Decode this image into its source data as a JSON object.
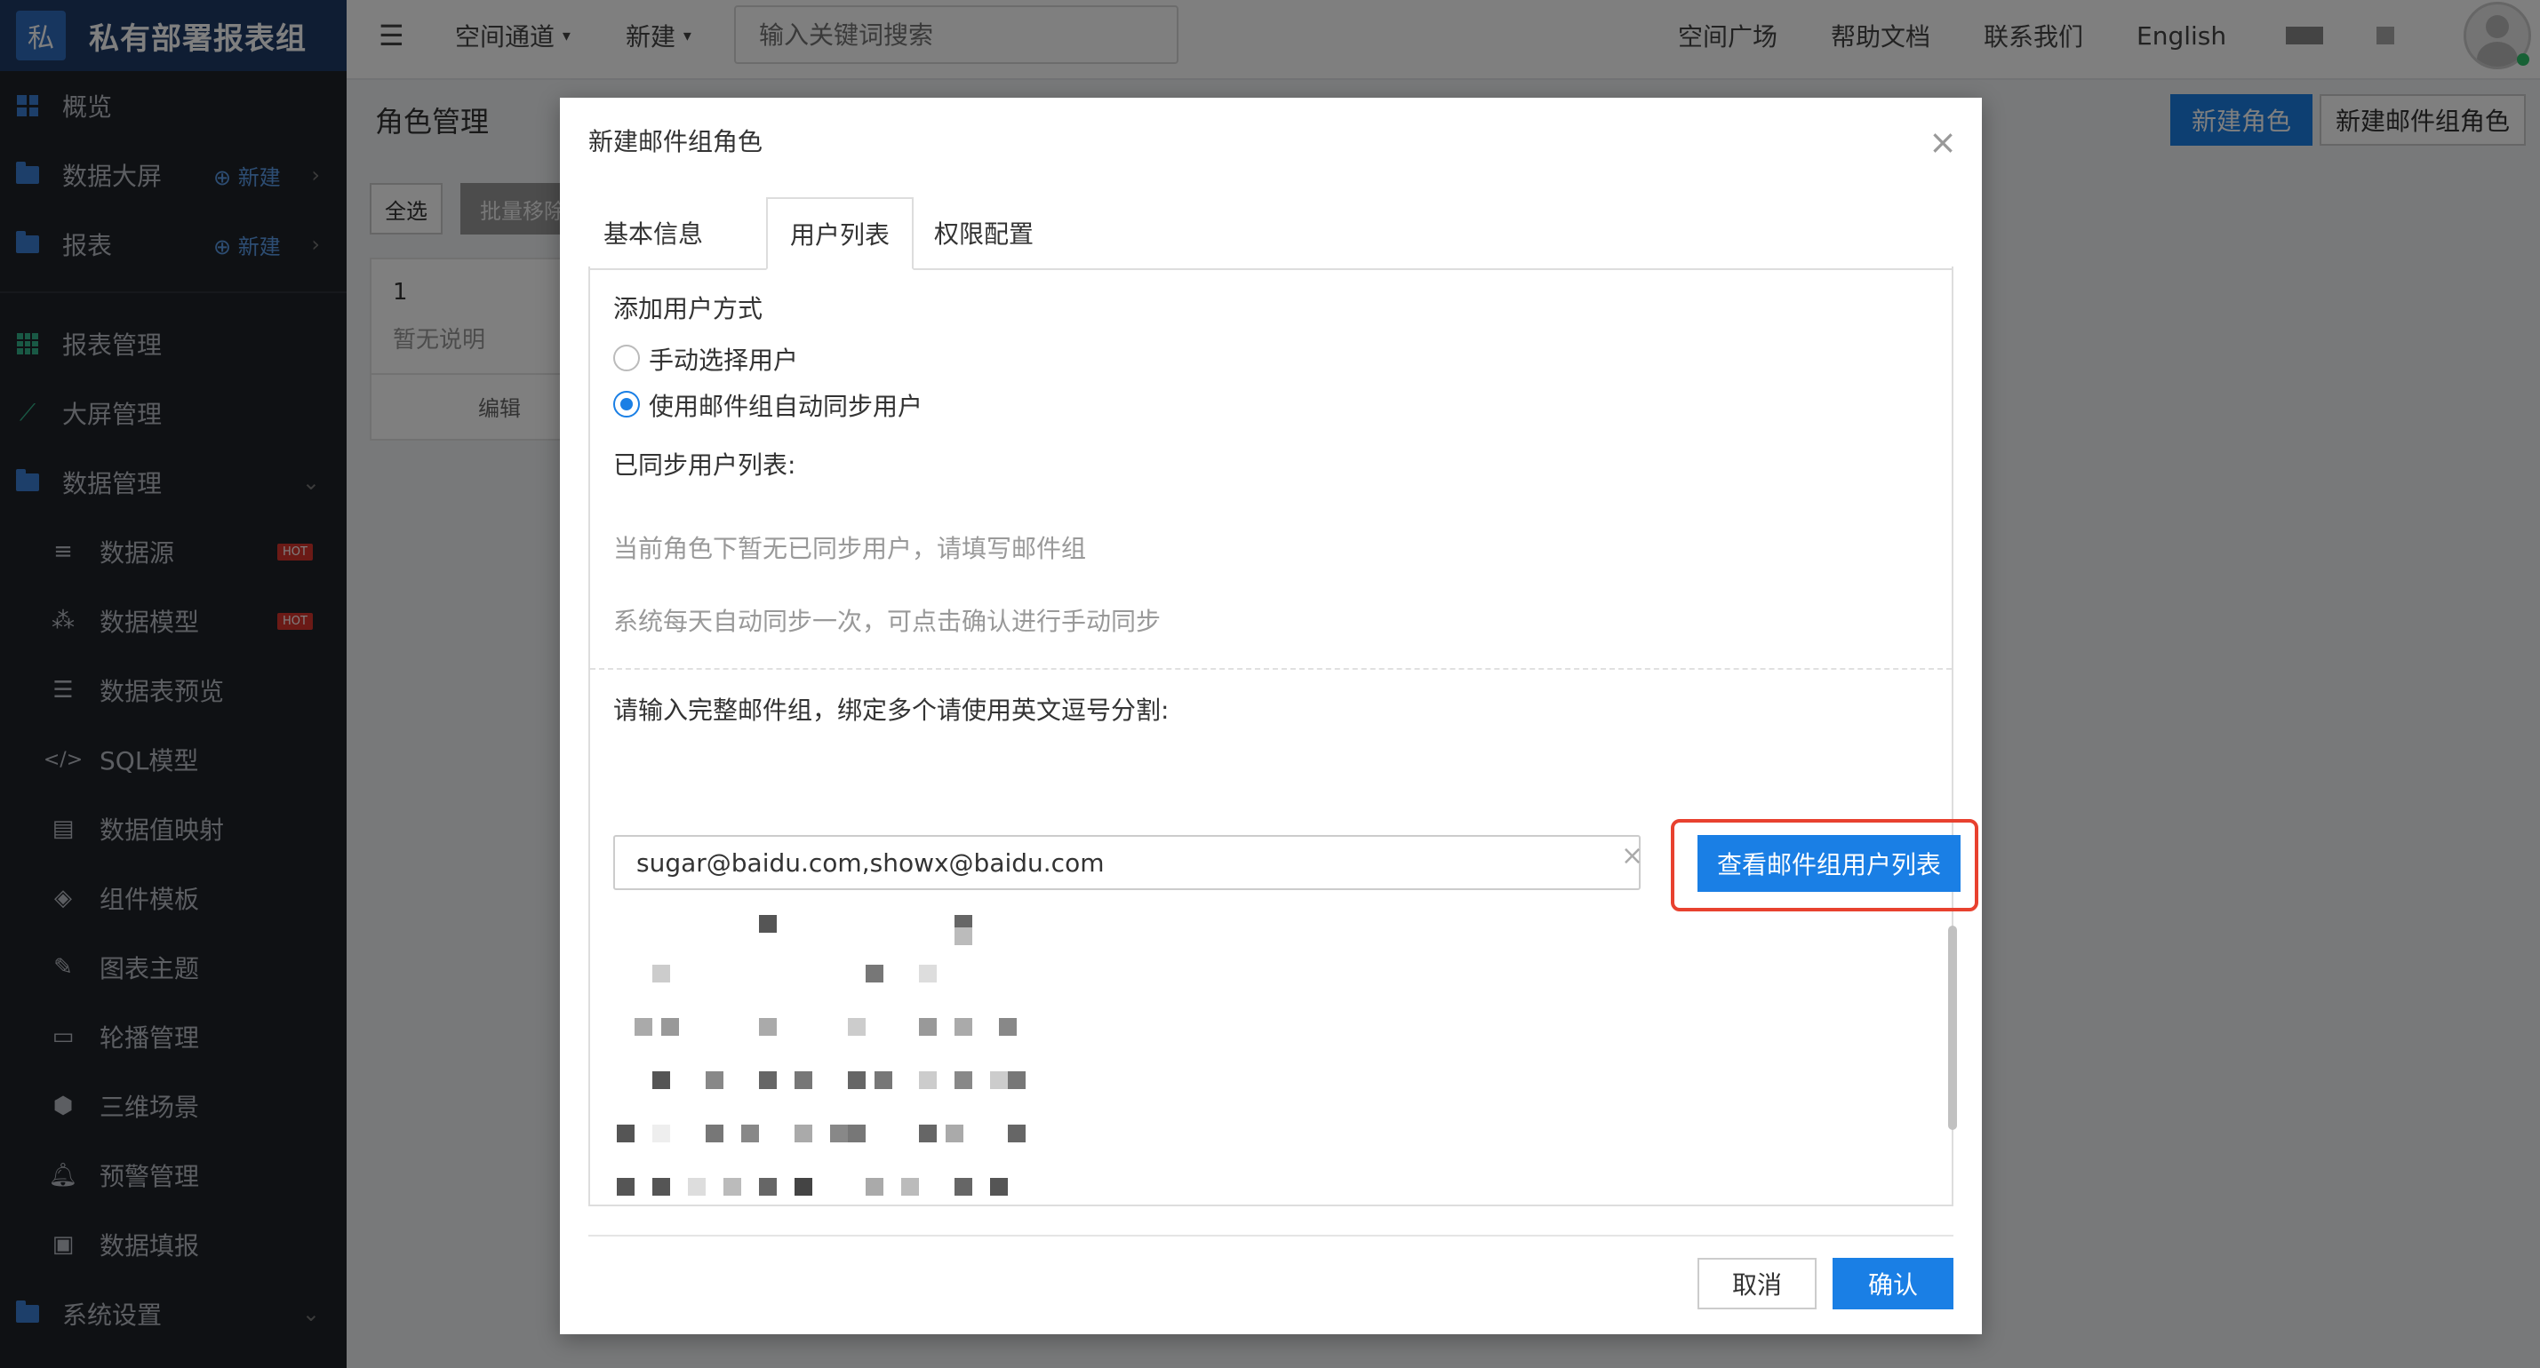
{
  "brand": {
    "logo_char": "私",
    "title": "私有部署报表组"
  },
  "sidebar": {
    "items": [
      {
        "label": "概览",
        "icon": "dashboard-icon"
      },
      {
        "label": "数据大屏",
        "icon": "folder-icon",
        "new_label": "新建"
      },
      {
        "label": "报表",
        "icon": "folder-icon",
        "new_label": "新建"
      },
      {
        "label": "报表管理",
        "icon": "grid-icon"
      },
      {
        "label": "大屏管理",
        "icon": "line-chart-icon"
      },
      {
        "label": "数据管理",
        "icon": "folder-icon"
      }
    ],
    "subitems": [
      {
        "label": "数据源",
        "icon": "database-icon",
        "badge": "HOT"
      },
      {
        "label": "数据模型",
        "icon": "model-icon",
        "badge": "HOT"
      },
      {
        "label": "数据表预览",
        "icon": "list-icon"
      },
      {
        "label": "SQL模型",
        "icon": "code-icon"
      },
      {
        "label": "数据值映射",
        "icon": "book-icon"
      },
      {
        "label": "组件模板",
        "icon": "cube-outline-icon"
      },
      {
        "label": "图表主题",
        "icon": "magic-wand-icon"
      },
      {
        "label": "轮播管理",
        "icon": "monitor-icon"
      },
      {
        "label": "三维场景",
        "icon": "cube-icon"
      },
      {
        "label": "预警管理",
        "icon": "bell-icon"
      },
      {
        "label": "数据填报",
        "icon": "form-icon"
      }
    ],
    "settings": {
      "label": "系统设置",
      "icon": "folder-icon"
    }
  },
  "topbar": {
    "menu_icon": "menu-toggle-icon",
    "space_label": "空间通道",
    "new_label": "新建",
    "search_placeholder": "输入关键词搜索",
    "links": [
      "空间广场",
      "帮助文档",
      "联系我们",
      "English"
    ]
  },
  "page": {
    "title": "角色管理",
    "new_role": "新建角色",
    "new_email_role": "新建邮件组角色",
    "select_all": "全选",
    "batch_remove": "批量移除",
    "card": {
      "index": "1",
      "desc": "暂无说明",
      "edit": "编辑"
    }
  },
  "modal": {
    "title": "新建邮件组角色",
    "tabs": [
      "基本信息",
      "用户列表",
      "权限配置"
    ],
    "active_tab": "用户列表",
    "add_method_label": "添加用户方式",
    "radio_manual": "手动选择用户",
    "radio_email": "使用邮件组自动同步用户",
    "selected_option": "使用邮件组自动同步用户",
    "synced_label": "已同步用户列表:",
    "hint1": "当前角色下暂无已同步用户，请填写邮件组",
    "hint2": "系统每天自动同步一次，可点击确认进行手动同步",
    "email_label": "请输入完整邮件组，绑定多个请使用英文逗号分割:",
    "email_value": "sugar@baidu.com,showx@baidu.com",
    "query_button": "查看邮件组用户列表",
    "cancel": "取消",
    "confirm": "确认"
  },
  "colors": {
    "primary": "#1a7fe5",
    "highlight": "#e8412f",
    "sidebar_bg": "#1f2329",
    "brand_bg": "#1e3a66"
  }
}
